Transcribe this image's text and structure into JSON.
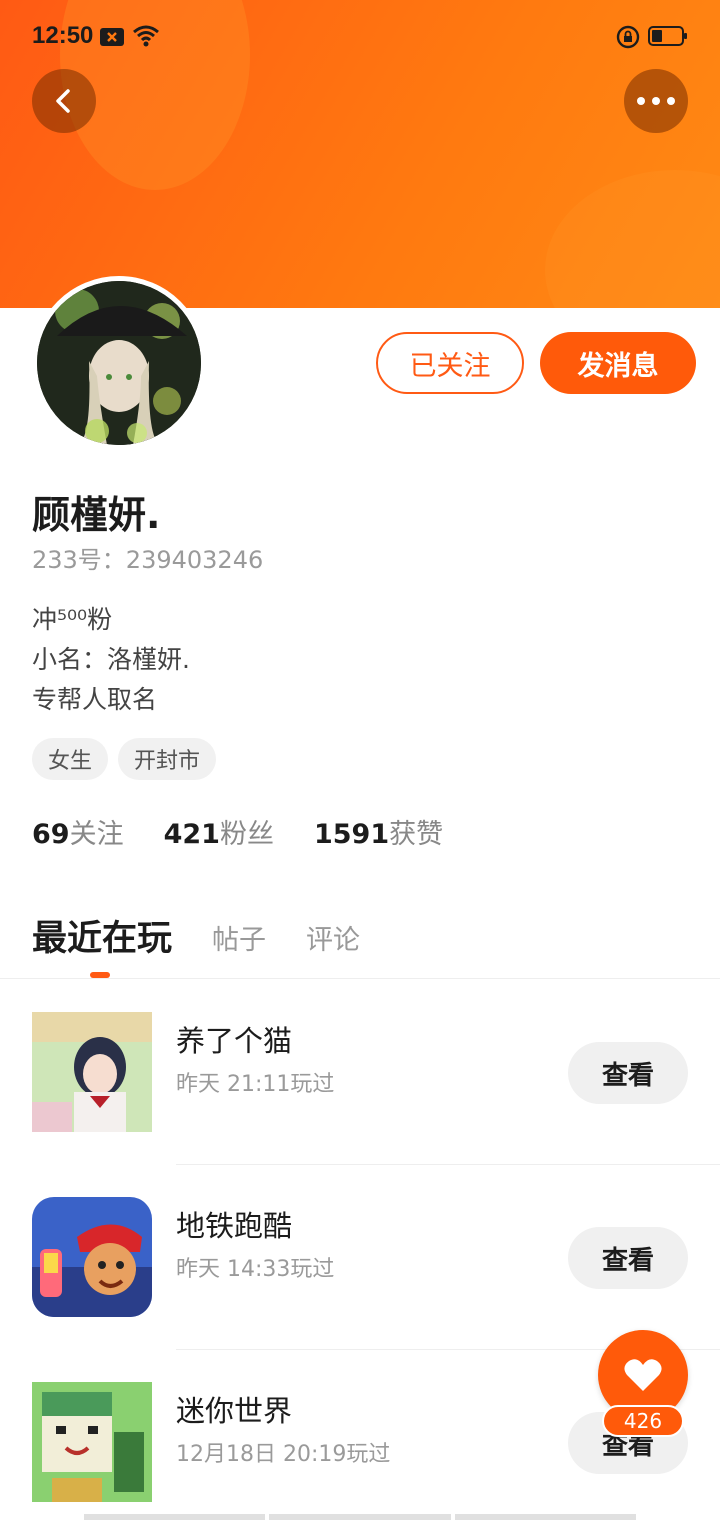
{
  "status_bar": {
    "time": "12:50",
    "icons": [
      "notification-x-icon",
      "wifi-icon",
      "rotation-lock-icon",
      "battery-icon"
    ]
  },
  "header": {
    "back_icon": "chevron-left-icon",
    "more_icon": "more-dots-icon",
    "accent_color": "#ff5a14"
  },
  "profile": {
    "avatar_icon": "avatar",
    "follow_label": "已关注",
    "message_label": "发消息",
    "name": "顾槿妍.",
    "uid": "233号：239403246",
    "bio_lines": [
      "冲⁵⁰⁰粉",
      "小名：洛槿妍.",
      "专帮人取名"
    ],
    "tags": [
      "女生",
      "开封市"
    ],
    "stats": [
      {
        "value": "69",
        "label": "关注"
      },
      {
        "value": "421",
        "label": "粉丝"
      },
      {
        "value": "1591",
        "label": "获赞"
      }
    ]
  },
  "tabs": [
    {
      "label": "最近在玩",
      "active": true
    },
    {
      "label": "帖子",
      "active": false
    },
    {
      "label": "评论",
      "active": false
    }
  ],
  "games": [
    {
      "name": "养了个猫",
      "time": "昨天 21:11玩过",
      "button": "查看"
    },
    {
      "name": "地铁跑酷",
      "time": "昨天 14:33玩过",
      "button": "查看"
    },
    {
      "name": "迷你世界",
      "time": "12月18日 20:19玩过",
      "button": "查看"
    }
  ],
  "like_fab": {
    "icon": "heart-icon",
    "count": "426"
  }
}
